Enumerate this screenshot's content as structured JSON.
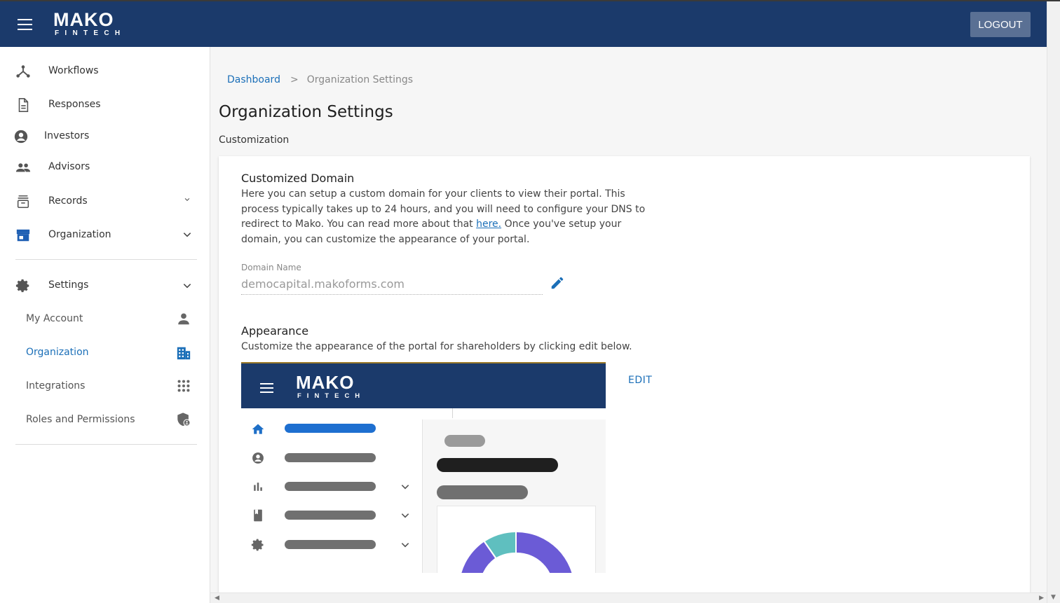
{
  "header": {
    "logo_main": "MAKO",
    "logo_sub": "FINTECH",
    "logout_label": "LOGOUT"
  },
  "sidebar": {
    "items": [
      {
        "label": "Workflows",
        "icon": "workflow-icon"
      },
      {
        "label": "Responses",
        "icon": "document-icon"
      },
      {
        "label": "Investors",
        "icon": "account-circle-icon"
      },
      {
        "label": "Advisors",
        "icon": "people-icon"
      },
      {
        "label": "Records",
        "icon": "archive-icon"
      },
      {
        "label": "Organization",
        "icon": "store-icon"
      }
    ],
    "settings": {
      "label": "Settings",
      "icon": "gear-icon",
      "sub_items": [
        {
          "label": "My Account",
          "icon": "person-icon"
        },
        {
          "label": "Organization",
          "icon": "building-icon",
          "active": true
        },
        {
          "label": "Integrations",
          "icon": "apps-grid-icon"
        },
        {
          "label": "Roles and Permissions",
          "icon": "admin-shield-icon"
        }
      ]
    }
  },
  "breadcrumb": {
    "root": "Dashboard",
    "separator": ">",
    "current": "Organization Settings"
  },
  "page": {
    "title": "Organization Settings",
    "section": "Customization"
  },
  "domain": {
    "heading": "Customized Domain",
    "desc_part1": "Here you can setup a custom domain for your clients to view their portal. This process typically takes up to 24 hours, and you will need to configure your DNS to redirect to Mako. You can read more about that ",
    "desc_link": "here.",
    "desc_part2": " Once you've setup your domain, you can customize the appearance of your portal.",
    "field_label": "Domain Name",
    "field_value": "democapital.makoforms.com"
  },
  "appearance": {
    "heading": "Appearance",
    "desc": "Customize the appearance of the portal for shareholders by clicking edit below.",
    "edit_label": "EDIT",
    "preview_logo_main": "MAKO",
    "preview_logo_sub": "FINTECH"
  },
  "colors": {
    "brand_navy": "#1b3a6b",
    "link_blue": "#1b6fb8",
    "chart_purple": "#6b5bd6",
    "chart_teal": "#5fbfbf"
  }
}
